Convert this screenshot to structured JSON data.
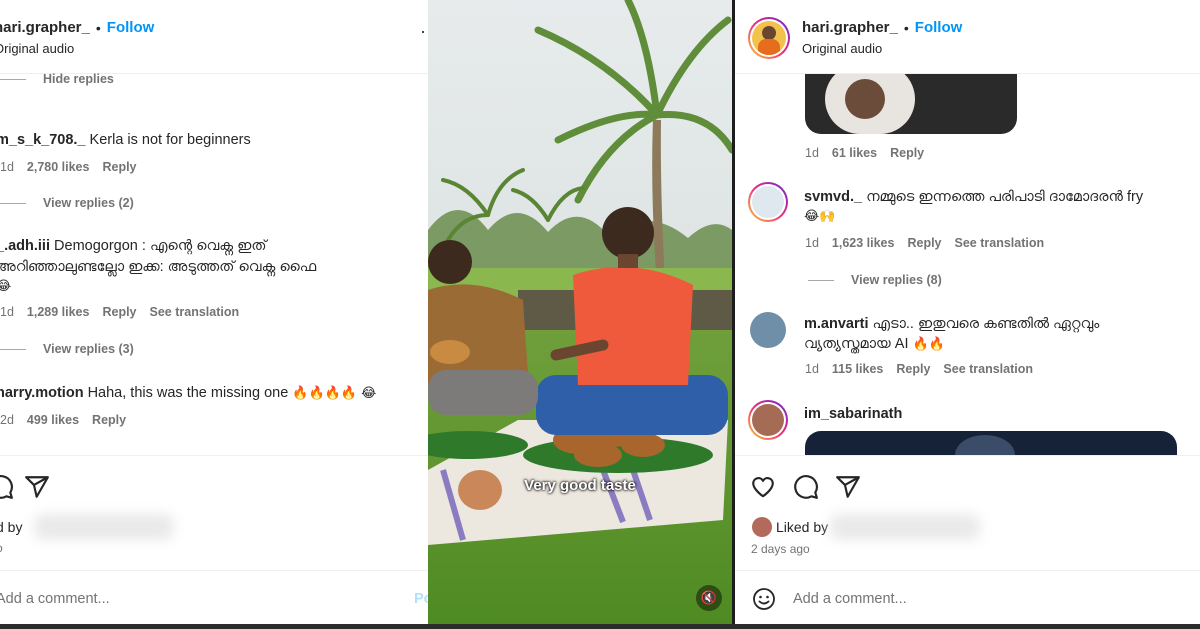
{
  "left_post": {
    "username": "hari.grapher_",
    "separator": "•",
    "follow": "Follow",
    "audio": "Original audio",
    "hide_replies": "Hide replies",
    "comments": [
      {
        "user": "m_s_k_708._",
        "text": "Kerla is not for beginners",
        "time": "1d",
        "likes": "2,780 likes",
        "reply": "Reply",
        "view_replies": "View replies (2)"
      },
      {
        "user": "_.adh.iii",
        "line1": "Demogorgon : എന്റെ വെക്ന ഇത്",
        "line2": "അറിഞ്ഞാലുണ്ടല്ലോ ഇക്ക: അടുത്തത് വെക്ന ഫൈ",
        "emoji": "😂",
        "time": "1d",
        "likes": "1,289 likes",
        "reply": "Reply",
        "translation": "See translation",
        "view_replies": "View replies (3)"
      },
      {
        "user": "harry.motion",
        "text": "Haha, this was the missing one",
        "emoji": "🔥🔥🔥🔥 😂",
        "time": "2d",
        "likes": "499 likes",
        "reply": "Reply"
      }
    ],
    "liked_by": "Liked by",
    "add_comment": "Add a comment...",
    "post_label": "Post"
  },
  "video": {
    "caption": "Very good taste",
    "mute_icon": "speaker-muted-icon"
  },
  "right_post": {
    "username": "hari.grapher_",
    "separator": "•",
    "follow": "Follow",
    "audio": "Original audio",
    "comments": [
      {
        "time": "1d",
        "likes": "61 likes",
        "reply": "Reply"
      },
      {
        "user": "svmvd._",
        "text": "നമ്മുടെ ഇന്നത്തെ പരിപാടി ദാമോദരൻ fry",
        "emoji": "😂🙌",
        "time": "1d",
        "likes": "1,623 likes",
        "reply": "Reply",
        "translation": "See translation",
        "view_replies": "View replies (8)"
      },
      {
        "user": "m.anvarti",
        "line1": "എടാ.. ഇതുവരെ കണ്ടതിൽ ഏറ്റവും",
        "line2": "വ്യത്യസ്തമായ AI",
        "emoji": "🔥🔥",
        "time": "1d",
        "likes": "115 likes",
        "reply": "Reply",
        "translation": "See translation"
      },
      {
        "user": "im_sabarinath"
      }
    ],
    "liked_by": "Liked by",
    "days_ago": "2 days ago",
    "add_comment": "Add a comment..."
  },
  "colors": {
    "accent": "#0095f6",
    "text": "#262626",
    "secondary": "#737373"
  }
}
